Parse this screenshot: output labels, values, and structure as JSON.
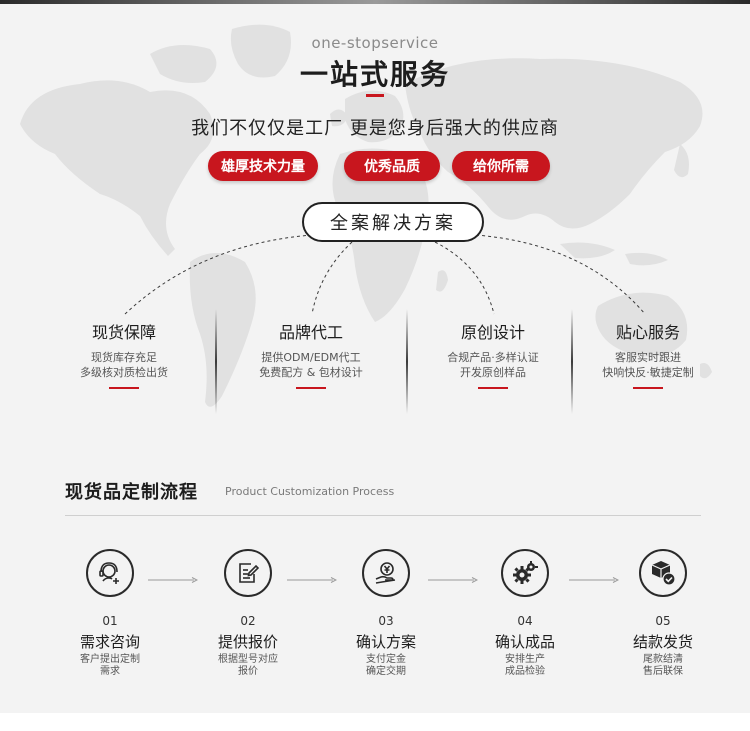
{
  "header": {
    "en_title": "one-stopservice",
    "title": "一站式服务",
    "tagline": "我们不仅仅是工厂 更是您身后强大的供应商"
  },
  "pills": [
    {
      "label": "雄厚技术力量"
    },
    {
      "label": "优秀品质"
    },
    {
      "label": "给你所需"
    }
  ],
  "solution": {
    "label": "全案解决方案"
  },
  "columns": [
    {
      "title": "现货保障",
      "desc1": "现货库存充足",
      "desc2": "多级核对质检出货"
    },
    {
      "title": "品牌代工",
      "desc1": "提供ODM/EDM代工",
      "desc2": "免费配方 & 包材设计"
    },
    {
      "title": "原创设计",
      "desc1": "合规产品·多样认证",
      "desc2": "开发原创样品"
    },
    {
      "title": "贴心服务",
      "desc1": "客服实时跟进",
      "desc2": "快响快反·敏捷定制"
    }
  ],
  "process": {
    "title": "现货品定制流程",
    "subtitle": "Product Customization Process",
    "steps": [
      {
        "num": "01",
        "title": "需求咨询",
        "desc1": "客户提出定制",
        "desc2": "需求",
        "icon": "consult-headset-icon"
      },
      {
        "num": "02",
        "title": "提供报价",
        "desc1": "根据型号对应",
        "desc2": "报价",
        "icon": "document-edit-icon"
      },
      {
        "num": "03",
        "title": "确认方案",
        "desc1": "支付定金",
        "desc2": "确定交期",
        "icon": "yen-hand-icon"
      },
      {
        "num": "04",
        "title": "确认成品",
        "desc1": "安排生产",
        "desc2": "成品检验",
        "icon": "gears-icon"
      },
      {
        "num": "05",
        "title": "结款发货",
        "desc1": "尾款结清",
        "desc2": "售后联保",
        "icon": "package-check-icon"
      }
    ]
  },
  "colors": {
    "accent": "#c8161e",
    "background": "#f3f3f3",
    "map": "#e2e2e2",
    "text": "#1d1d1d"
  }
}
